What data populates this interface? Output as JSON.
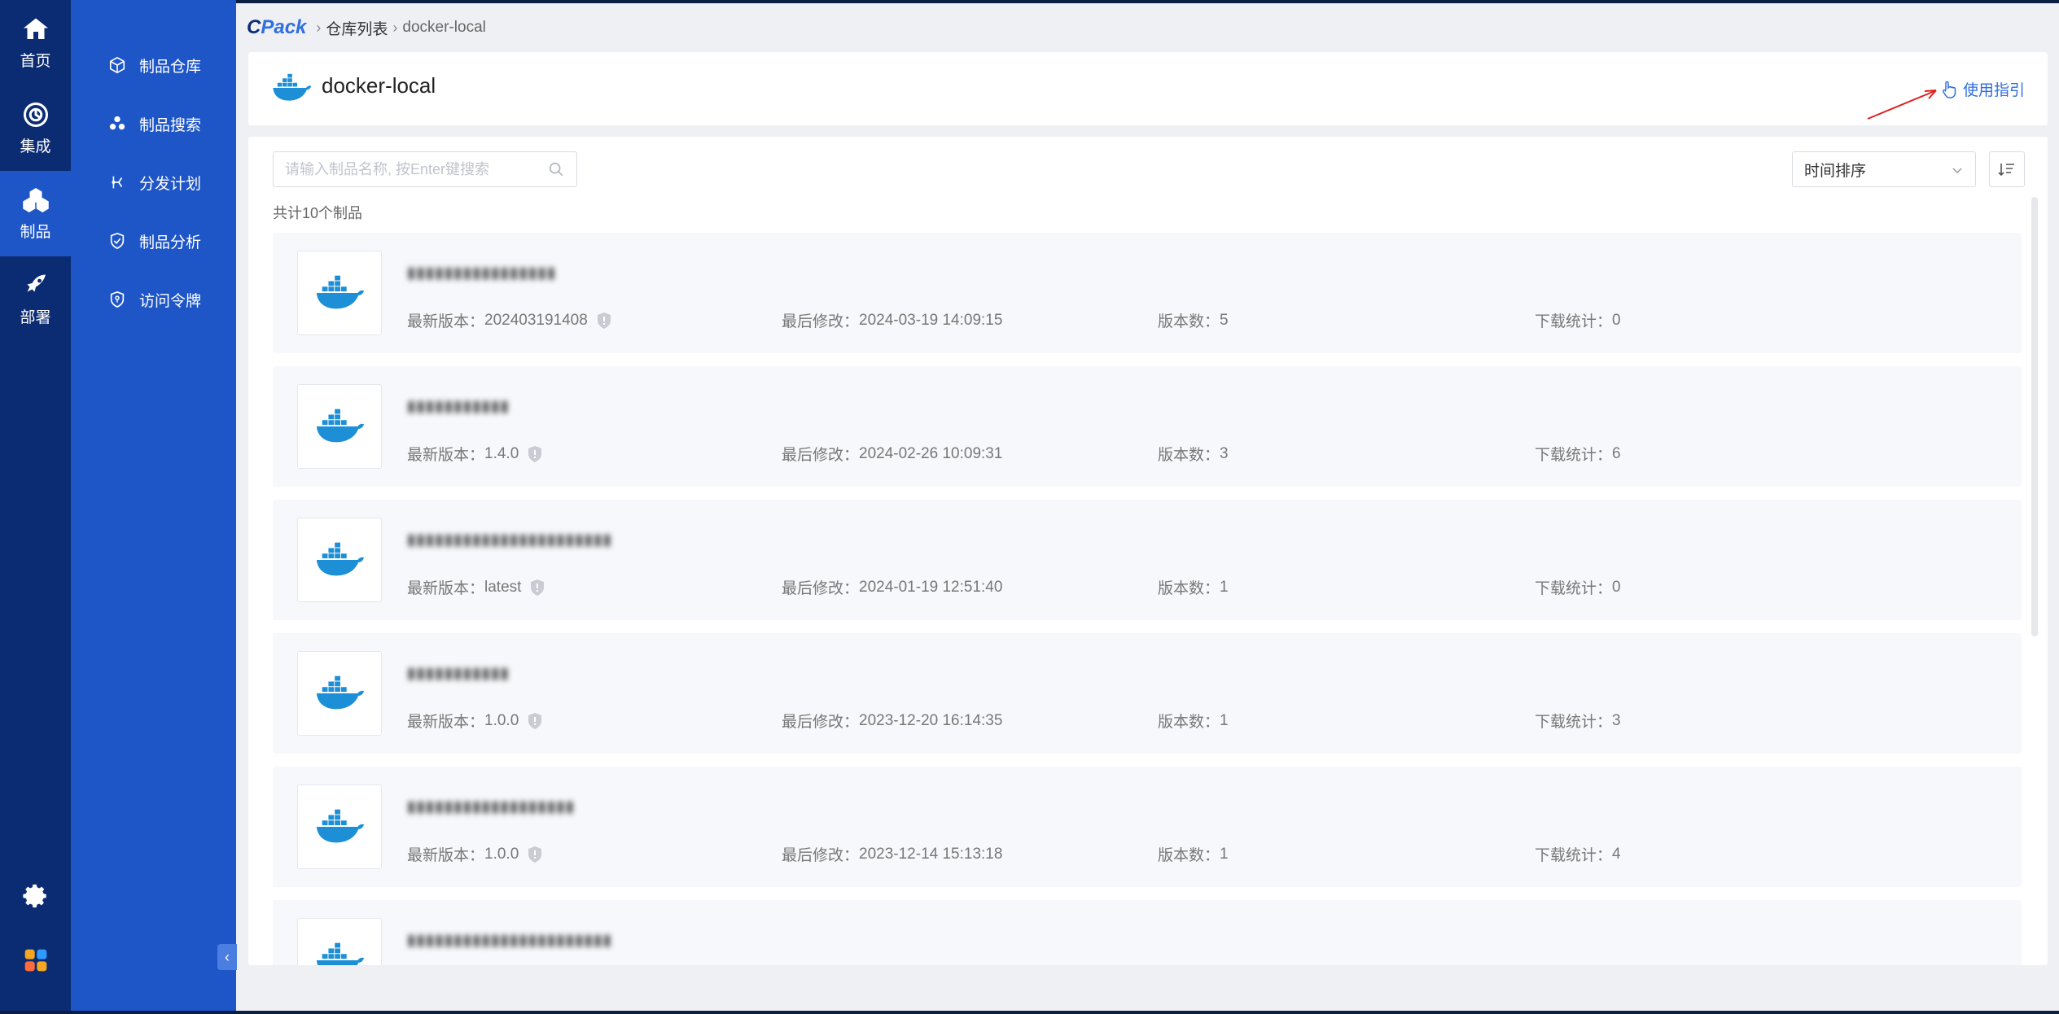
{
  "rail": {
    "items": [
      {
        "label": "首页",
        "icon": "home-icon"
      },
      {
        "label": "集成",
        "icon": "integration-icon"
      },
      {
        "label": "制品",
        "icon": "artifact-icon"
      },
      {
        "label": "部署",
        "icon": "rocket-icon"
      }
    ],
    "active_index": 2
  },
  "sidebar": {
    "items": [
      {
        "label": "制品仓库",
        "icon": "cube-icon"
      },
      {
        "label": "制品搜索",
        "icon": "cubes-icon"
      },
      {
        "label": "分发计划",
        "icon": "distribute-icon"
      },
      {
        "label": "制品分析",
        "icon": "shield-check-icon"
      },
      {
        "label": "访问令牌",
        "icon": "token-icon"
      }
    ]
  },
  "breadcrumb": {
    "brand_c": "C",
    "brand_rest": "Pack",
    "items": [
      "仓库列表",
      "docker-local"
    ]
  },
  "header": {
    "title": "docker-local",
    "guide_label": "使用指引"
  },
  "toolbar": {
    "search_placeholder": "请输入制品名称, 按Enter键搜索",
    "sort_value": "时间排序"
  },
  "total_text": "共计10个制品",
  "labels": {
    "latest_version": "最新版本：",
    "last_modified": "最后修改：",
    "version_count": "版本数：",
    "download_stats": "下载统计："
  },
  "artifacts": [
    {
      "name": "▮▮▮▮▮▮▮▮▮▮▮▮▮▮▮▮",
      "latest_version": "202403191408",
      "last_modified": "2024-03-19 14:09:15",
      "version_count": "5",
      "downloads": "0"
    },
    {
      "name": "▮▮▮▮▮▮▮▮▮▮▮",
      "latest_version": "1.4.0",
      "last_modified": "2024-02-26 10:09:31",
      "version_count": "3",
      "downloads": "6"
    },
    {
      "name": "▮▮▮▮▮▮▮▮▮▮▮▮▮▮▮▮▮▮▮▮▮▮",
      "latest_version": "latest",
      "last_modified": "2024-01-19 12:51:40",
      "version_count": "1",
      "downloads": "0"
    },
    {
      "name": "▮▮▮▮▮▮▮▮▮▮▮",
      "latest_version": "1.0.0",
      "last_modified": "2023-12-20 16:14:35",
      "version_count": "1",
      "downloads": "3"
    },
    {
      "name": "▮▮▮▮▮▮▮▮▮▮▮▮▮▮▮▮▮▮",
      "latest_version": "1.0.0",
      "last_modified": "2023-12-14 15:13:18",
      "version_count": "1",
      "downloads": "4"
    },
    {
      "name": "▮▮▮▮▮▮▮▮▮▮▮▮▮▮▮▮▮▮▮▮▮▮",
      "latest_version": "",
      "last_modified": "",
      "version_count": "",
      "downloads": ""
    }
  ],
  "colors": {
    "rail_bg": "#0b2c73",
    "sidebar_bg": "#1e56c8",
    "accent": "#2f6ee0",
    "docker_blue": "#1d8fd6",
    "annotation_red": "#e02020"
  }
}
